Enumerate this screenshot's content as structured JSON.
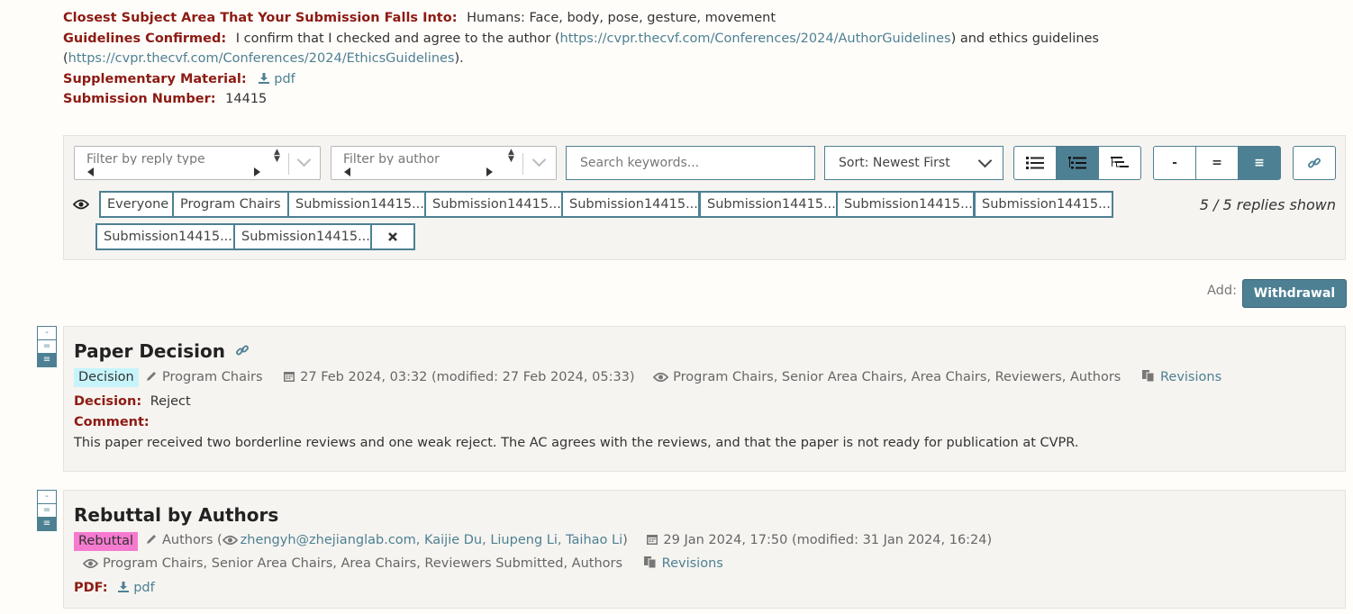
{
  "meta": {
    "subject_label": "Closest Subject Area That Your Submission Falls Into:",
    "subject_value": "Humans: Face, body, pose, gesture, movement",
    "guidelines_label": "Guidelines Confirmed:",
    "guidelines_text1": "I confirm that I checked and agree to the author (",
    "guidelines_link1": "https://cvpr.thecvf.com/Conferences/2024/AuthorGuidelines",
    "guidelines_text2": ") and ethics guidelines",
    "guidelines_text3": "(",
    "guidelines_link2": "https://cvpr.thecvf.com/Conferences/2024/EthicsGuidelines",
    "guidelines_text4": ").",
    "supp_label": "Supplementary Material:",
    "supp_link": "pdf",
    "subnum_label": "Submission Number:",
    "subnum_value": "14415"
  },
  "filters": {
    "reply_type_placeholder": "Filter by reply type",
    "author_placeholder": "Filter by author",
    "search_placeholder": "Search keywords...",
    "sort_value": "Sort: Newest First",
    "level_buttons": [
      "-",
      "=",
      "≡"
    ],
    "readers": [
      "Everyone",
      "Program Chairs",
      "Submission14415...",
      "Submission14415...",
      "Submission14415...",
      "Submission14415...",
      "Submission14415...",
      "Submission14415...",
      "Submission14415...",
      "Submission14415..."
    ],
    "clear_icon": "close-icon",
    "replies_shown": "5 / 5 replies shown"
  },
  "add": {
    "label": "Add:",
    "withdrawal": "Withdrawal"
  },
  "notes": [
    {
      "title": "Paper Decision",
      "badge": "Decision",
      "signature": "Program Chairs",
      "date": "27 Feb 2024, 03:32 (modified: 27 Feb 2024, 05:33)",
      "readers": "Program Chairs, Senior Area Chairs, Area Chairs, Reviewers, Authors",
      "revisions": "Revisions",
      "decision_label": "Decision:",
      "decision_value": "Reject",
      "comment_label": "Comment:",
      "comment_value": "This paper received two borderline reviews and one weak reject. The AC agrees with the reviews, and that the paper is not ready for publication at CVPR."
    },
    {
      "title": "Rebuttal by Authors",
      "badge": "Rebuttal",
      "signature_prefix": "Authors (",
      "authors": "zhengyh@zhejianglab.com, Kaijie Du, Liupeng Li, Taihao Li",
      "signature_suffix": ")",
      "date": "29 Jan 2024, 17:50 (modified: 31 Jan 2024, 16:24)",
      "readers": "Program Chairs, Senior Area Chairs, Area Chairs, Reviewers Submitted, Authors",
      "revisions": "Revisions",
      "pdf_label": "PDF:",
      "pdf_link": "pdf"
    }
  ],
  "colors": {
    "accent": "#4d8093",
    "label": "#8c1b13",
    "decision_badge": "#c7f4fb",
    "rebuttal_badge": "#f57ad0"
  }
}
